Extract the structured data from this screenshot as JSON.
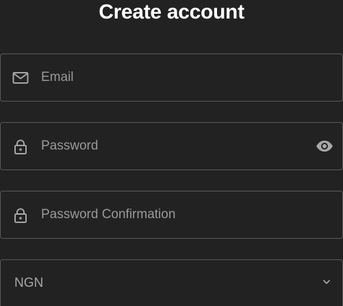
{
  "header": {
    "title": "Create account"
  },
  "form": {
    "email": {
      "placeholder": "Email",
      "value": "",
      "icon": "mail-icon"
    },
    "password": {
      "placeholder": "Password",
      "value": "",
      "icon": "lock-icon",
      "toggle_icon": "eye-icon"
    },
    "password_confirmation": {
      "placeholder": "Password Confirmation",
      "value": "",
      "icon": "lock-icon"
    },
    "currency": {
      "selected": "NGN",
      "icon": "chevron-down-icon"
    }
  },
  "colors": {
    "background": "#222222",
    "border": "#5b5b5b",
    "text": "#ffffff",
    "placeholder": "#9a9a9a",
    "icon": "#a8a8a8"
  }
}
